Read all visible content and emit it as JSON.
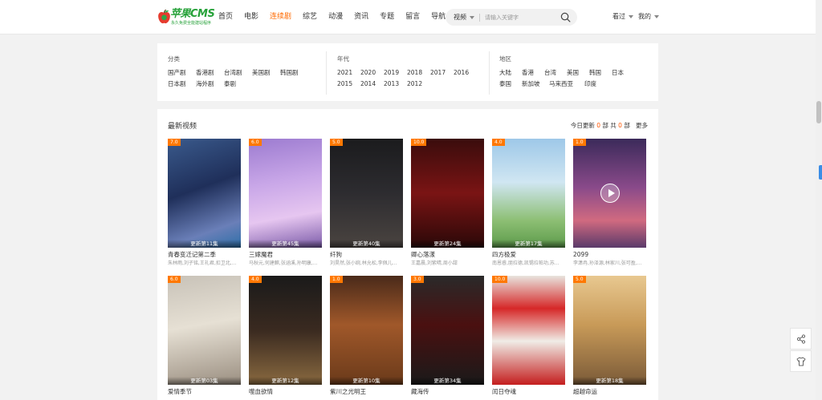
{
  "header": {
    "logo": {
      "title": "苹果CMS",
      "subtitle": "永久免费全能建站程序"
    },
    "nav": [
      {
        "label": "首页",
        "active": false
      },
      {
        "label": "电影",
        "active": false
      },
      {
        "label": "连续剧",
        "active": true
      },
      {
        "label": "综艺",
        "active": false
      },
      {
        "label": "动漫",
        "active": false
      },
      {
        "label": "资讯",
        "active": false
      },
      {
        "label": "专题",
        "active": false
      },
      {
        "label": "留言",
        "active": false
      },
      {
        "label": "导航",
        "active": false
      }
    ],
    "search": {
      "type": "视频",
      "placeholder": "请输入关键字"
    },
    "history": "看过",
    "mine": "我的"
  },
  "filter": {
    "category": {
      "title": "分类",
      "rows": [
        [
          "国产剧",
          "香港剧",
          "台湾剧",
          "美国剧",
          "韩国剧"
        ],
        [
          "日本剧",
          "海外剧",
          "泰剧"
        ]
      ]
    },
    "year": {
      "title": "年代",
      "rows": [
        [
          "2021",
          "2020",
          "2019",
          "2018",
          "2017",
          "2016"
        ],
        [
          "2015",
          "2014",
          "2013",
          "2012"
        ]
      ]
    },
    "region": {
      "title": "地区",
      "rows": [
        [
          "大陆",
          "香港",
          "台湾",
          "美国",
          "韩国",
          "日本"
        ],
        [
          "泰国",
          "新加坡",
          "马来西亚",
          "印度"
        ]
      ]
    }
  },
  "latest": {
    "title": "最新视频",
    "today_label": "今日更新",
    "today_count": "0",
    "unit": "部",
    "total_label": "共",
    "total_count": "0",
    "more": "更多"
  },
  "videos": [
    {
      "score": "7.0",
      "status": "更新第11集",
      "title": "青春变迁记第二季",
      "cast": "朱林雨,刘子铭,王礼君,扣卫北,..."
    },
    {
      "score": "6.0",
      "status": "更新第45集",
      "title": "三嫁魔君",
      "cast": "马秋元,何建麒,张涵溪,孙明康,赵..."
    },
    {
      "score": "5.0",
      "status": "更新第40集",
      "title": "纤狗",
      "cast": "刘昊然,张小婉,林允松,李佩儿..."
    },
    {
      "score": "10.0",
      "status": "更新第24集",
      "title": "卿心落漾",
      "cast": "王嘉晨,刘紫晴,周小甜"
    },
    {
      "score": "4.0",
      "status": "更新第17集",
      "title": "四方极爱",
      "cast": "南恩睿,朋拉德,凯锡拉帕功,苏..."
    },
    {
      "score": "1.0",
      "status": "",
      "title": "2099",
      "cast": "李潇冉,孙泽源,林家川,张可盈,..."
    },
    {
      "score": "6.0",
      "status": "更新第03集",
      "title": "爱情季节",
      "cast": ""
    },
    {
      "score": "4.0",
      "status": "更新第12集",
      "title": "噬血欲情",
      "cast": ""
    },
    {
      "score": "1.0",
      "status": "更新第10集",
      "title": "紫川之光明王",
      "cast": ""
    },
    {
      "score": "3.0",
      "status": "更新第34集",
      "title": "藏海传",
      "cast": ""
    },
    {
      "score": "10.0",
      "status": "",
      "title": "闰日夺魂",
      "cast": ""
    },
    {
      "score": "5.0",
      "status": "更新第18集",
      "title": "超越命运",
      "cast": ""
    }
  ],
  "colors": {
    "accent": "#ff6a00",
    "brand": "#27a23a",
    "score_badge": "#ff7800"
  }
}
